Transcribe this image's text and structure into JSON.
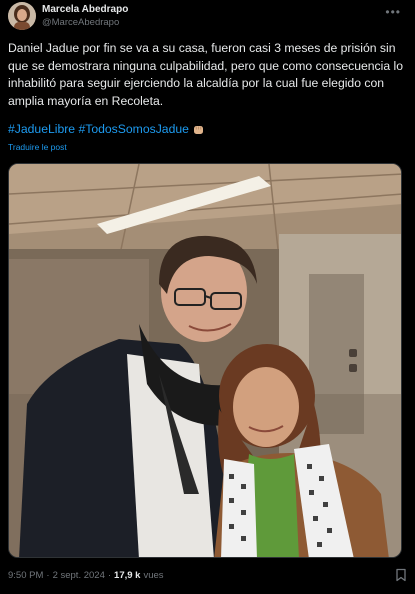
{
  "author": {
    "display_name": "Marcela Abedrapo",
    "handle": "@MarceAbedrapo",
    "more_icon": "more-dots-icon"
  },
  "tweet": {
    "text": "Daniel Jadue por fin se va a su casa, fueron casi 3 meses de prisión sin que se demostrara ninguna culpabilidad, pero que como consecuencia lo inhabilitó para seguir ejerciendo la alcaldía por la cual fue elegido con amplia mayoría en Recoleta.",
    "hashtags": "#JadueLibre #TodosSomosJadue",
    "emoji": "raised-fist-emoji",
    "translate_link": "Traduire le post"
  },
  "footer": {
    "time": "9:50 PM",
    "sep1": "·",
    "date": "2 sept. 2024",
    "sep2": "·",
    "views_count": "17,9 k",
    "views_label": "vues",
    "bookmark_icon": "bookmark-icon"
  },
  "colors": {
    "background": "#000000",
    "text": "#e7e9ea",
    "muted": "#71767b",
    "link": "#1d9bf0"
  }
}
